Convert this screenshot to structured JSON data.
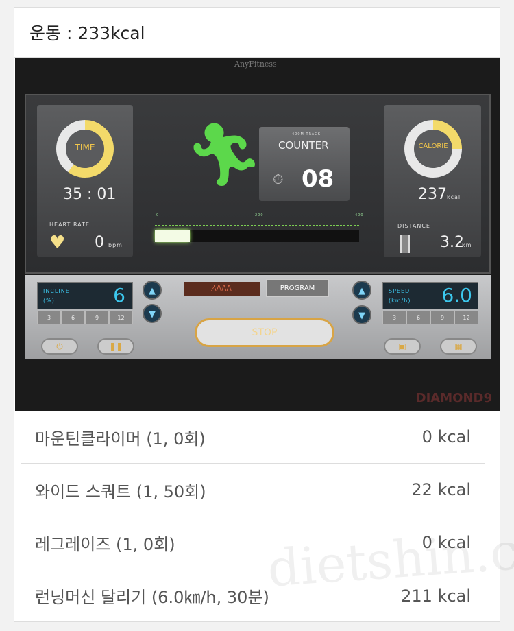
{
  "header": {
    "title": "운동 : 233kcal"
  },
  "photo": {
    "brand": "AnyFitness",
    "time_label": "TIME",
    "time_value": "35 : 01",
    "heart_rate_label": "HEART RATE",
    "heart_rate_value": "0",
    "heart_rate_unit": "bpm",
    "counter_caption": "400M TRACK",
    "counter_label": "COUNTER",
    "counter_value": "08",
    "track_ticks": [
      "0",
      "200",
      "400"
    ],
    "calorie_label": "CALORIE",
    "calorie_value": "237",
    "calorie_unit": "kcal",
    "distance_label": "DISTANCE",
    "distance_value": "3.2",
    "distance_unit": "km",
    "incline_label": "INCLINE",
    "incline_unit": "(%)",
    "incline_value": "6",
    "speed_label": "SPEED",
    "speed_unit": "(km/h)",
    "speed_value": "6.0",
    "presets": [
      "3",
      "6",
      "9",
      "12"
    ],
    "program_label": "PROGRAM",
    "stop_label": "STOP",
    "model": "DIAMOND9"
  },
  "exercises": [
    {
      "name": "마운틴클라이머 (1, 0회)",
      "kcal": "0 kcal"
    },
    {
      "name": "와이드 스쿼트 (1, 50회)",
      "kcal": "22 kcal"
    },
    {
      "name": "레그레이즈 (1, 0회)",
      "kcal": "0 kcal"
    },
    {
      "name": "런닝머신 달리기 (6.0㎞/h, 30분)",
      "kcal": "211 kcal"
    }
  ],
  "watermark": "dietshin.com"
}
